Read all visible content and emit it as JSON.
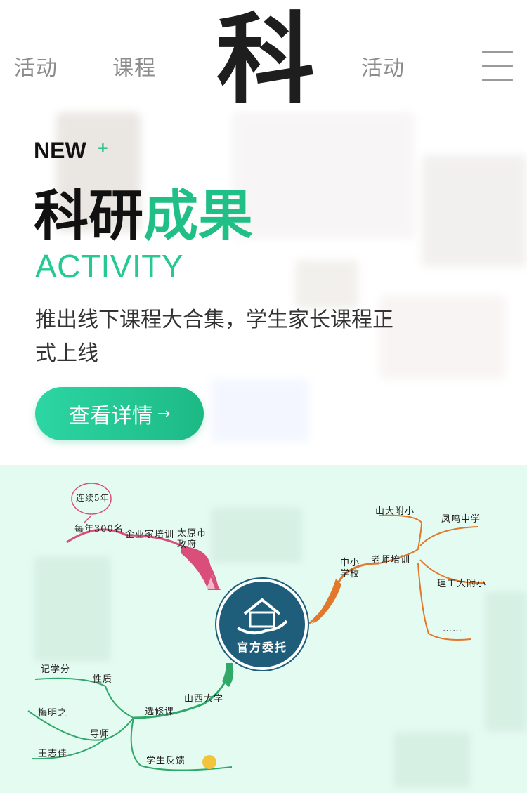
{
  "header": {
    "nav_left_1": "活动",
    "nav_left_2": "课程",
    "logo_char": "科",
    "nav_right_1": "活动",
    "menu_icon": "hamburger-menu-icon"
  },
  "hero": {
    "badge": "NEW",
    "badge_plus": "+",
    "title_part1": "科研",
    "title_part2": "成果",
    "subtitle": "ACTIVITY",
    "description": "推出线下课程大合集，学生家长课程正式上线",
    "cta_label": "查看详情",
    "cta_arrow": "→",
    "accent_color": "#1fbf85"
  },
  "mindmap": {
    "center": "官方委托",
    "top_left": {
      "cloud": "连续5年",
      "per_year": "每年300名",
      "training": "企业家培训",
      "gov": "太原市政府"
    },
    "right": {
      "school": "中小学校",
      "teacher_training": "老师培训",
      "school_1": "山大附小",
      "school_2": "凤鸣中学",
      "school_3": "理工大附小",
      "more": "……"
    },
    "bottom_left": {
      "university": "山西大学",
      "elective": "选修课",
      "nature": "性质",
      "credit": "记学分",
      "mentor": "导师",
      "mentor_1": "梅明之",
      "mentor_2": "王志佳",
      "feedback": "学生反馈"
    },
    "colors": {
      "branch_top": "#d94f7a",
      "branch_right": "#e3772a",
      "branch_bottom": "#2fa86a",
      "center": "#1f5e7a"
    }
  }
}
